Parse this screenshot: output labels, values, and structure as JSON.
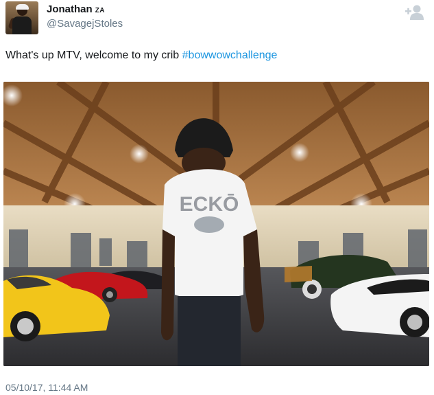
{
  "tweet": {
    "author": {
      "display_name": "Jonathan",
      "name_suffix": "ZA",
      "handle": "@SavagejStoles"
    },
    "text_prefix": "What's up MTV, welcome to my crib ",
    "hashtag": "#bowwowchallenge",
    "media": {
      "shirt_brand": "ECKŌ"
    },
    "timestamp": "05/10/17, 11:44 AM",
    "follow_icon": "follow-user-icon"
  },
  "colors": {
    "link": "#1b95e0",
    "secondary_text": "#657786",
    "primary_text": "#14171a",
    "follow_icon": "#c8d0d7"
  }
}
